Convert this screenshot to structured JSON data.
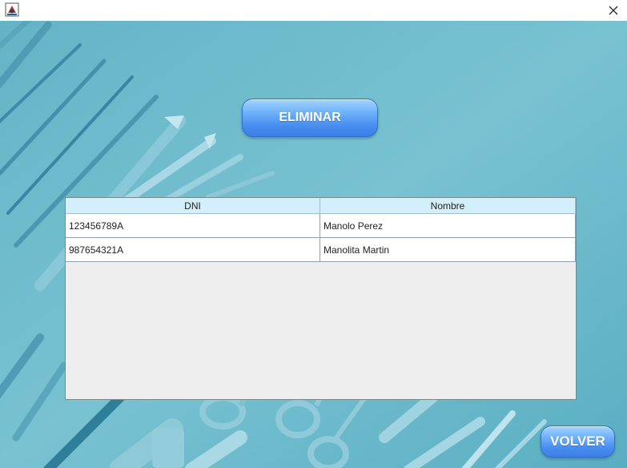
{
  "window": {
    "app_icon": "java-app-icon",
    "close_icon": "close-icon"
  },
  "actions": {
    "eliminar_label": "ELIMINAR",
    "volver_label": "VOLVER"
  },
  "table": {
    "columns": [
      "DNI",
      "Nombre"
    ],
    "rows": [
      [
        "123456789A",
        "Manolo Perez"
      ],
      [
        "987654321A",
        "Manolita Martin"
      ]
    ]
  },
  "colors": {
    "background": "#6fb9c9",
    "button_blue": "#4a8ef0",
    "header_bg": "#d3effc"
  }
}
